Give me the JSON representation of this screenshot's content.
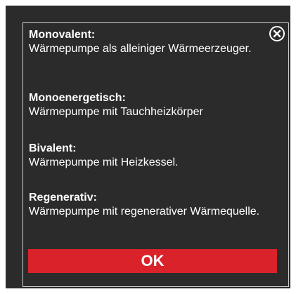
{
  "dialog": {
    "close_icon": "close-circle-icon",
    "sections": [
      {
        "title": "Monovalent:",
        "text": "Wärmepumpe als alleiniger Wärmeerzeuger."
      },
      {
        "title": "Monoenergetisch:",
        "text": "Wärmepumpe mit Tauchheizkörper"
      },
      {
        "title": "Bivalent:",
        "text": "Wärmepumpe mit Heizkessel."
      },
      {
        "title": "Regenerativ:",
        "text": "Wärmepumpe mit regenerativer Wärmequelle."
      }
    ],
    "ok_label": "OK"
  },
  "colors": {
    "background": "#2b2b2b",
    "accent": "#d9222a",
    "text": "#ffffff",
    "border": "#cfcfcf"
  }
}
